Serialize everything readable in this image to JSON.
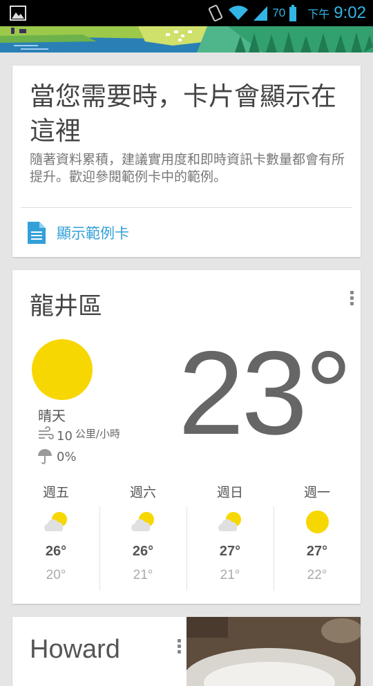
{
  "status_bar": {
    "battery_percent": "70",
    "ampm": "下午",
    "time": "9:02",
    "accent": "#33b5e5"
  },
  "empty_card": {
    "title": "當您需要時，卡片會顯示在這裡",
    "description": "隨著資料累積，建議實用度和即時資訊卡數量都會有所提升。歡迎參閱範例卡中的範例。",
    "action_label": "顯示範例卡",
    "action_icon": "document-icon"
  },
  "weather": {
    "location": "龍井區",
    "condition": "晴天",
    "temperature": "23°",
    "wind_value": "10",
    "wind_unit": "公里/小時",
    "precip": "0%",
    "forecast": [
      {
        "day": "週五",
        "icon": "partly-cloudy-icon",
        "high": "26°",
        "low": "20°"
      },
      {
        "day": "週六",
        "icon": "partly-cloudy-icon",
        "high": "26°",
        "low": "21°"
      },
      {
        "day": "週日",
        "icon": "partly-cloudy-icon",
        "high": "27°",
        "low": "21°"
      },
      {
        "day": "週一",
        "icon": "sunny-icon",
        "high": "27°",
        "low": "22°"
      }
    ]
  },
  "contact_card": {
    "name": "Howard"
  }
}
